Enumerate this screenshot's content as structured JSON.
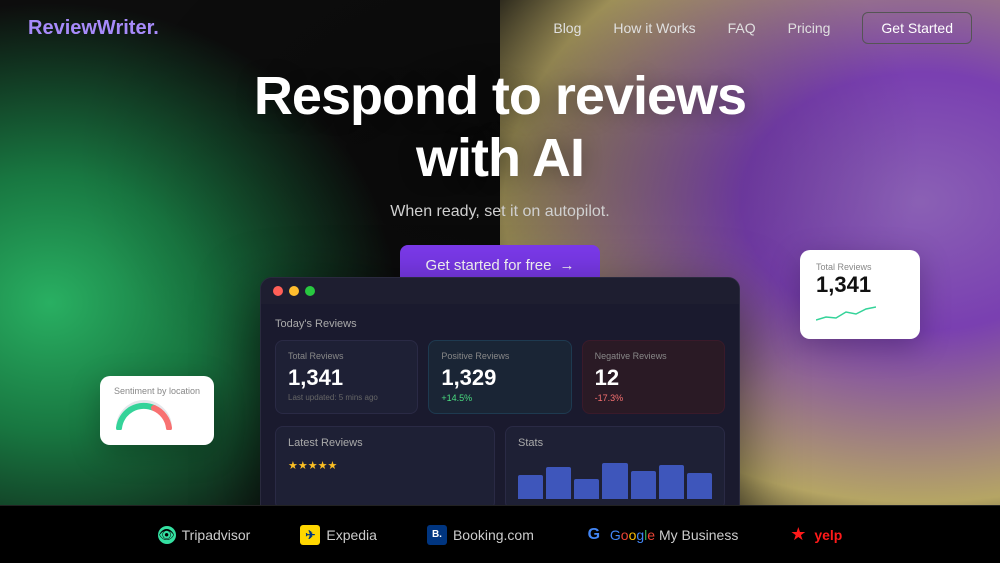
{
  "nav": {
    "logo_main": "ReviewWriter",
    "logo_dot": ".",
    "links": [
      {
        "label": "Blog",
        "id": "nav-blog"
      },
      {
        "label": "How it Works",
        "id": "nav-how"
      },
      {
        "label": "FAQ",
        "id": "nav-faq"
      },
      {
        "label": "Pricing",
        "id": "nav-pricing"
      }
    ],
    "cta": "Get Started"
  },
  "hero": {
    "title_line1": "Respond to reviews",
    "title_line2": "with AI",
    "subtitle": "When ready, set it on autopilot.",
    "cta_button": "Get started for free",
    "cta_arrow": "→"
  },
  "dashboard": {
    "section_title": "Today's Reviews",
    "total_reviews": {
      "label": "Total Reviews",
      "value": "1,341",
      "meta": "Last updated: 5 mins ago"
    },
    "positive_reviews": {
      "label": "Positive Reviews",
      "value": "1,329",
      "change": "+14.5%"
    },
    "negative_reviews": {
      "label": "Negative Reviews",
      "value": "12",
      "change": "-17.3%"
    },
    "latest_section": "Latest Reviews",
    "stats_section": "Stats",
    "stars": "★★★★★"
  },
  "float_top": {
    "label": "Total Reviews",
    "value": "1,341"
  },
  "float_bottom": {
    "label": "Sentiment by location"
  },
  "footer": {
    "logos": [
      {
        "id": "tripadvisor",
        "text": "Tripadvisor"
      },
      {
        "id": "expedia",
        "text": "Expedia"
      },
      {
        "id": "booking",
        "text": "Booking.com"
      },
      {
        "id": "google",
        "text": "My Business"
      },
      {
        "id": "yelp",
        "text": "yelp"
      }
    ]
  }
}
